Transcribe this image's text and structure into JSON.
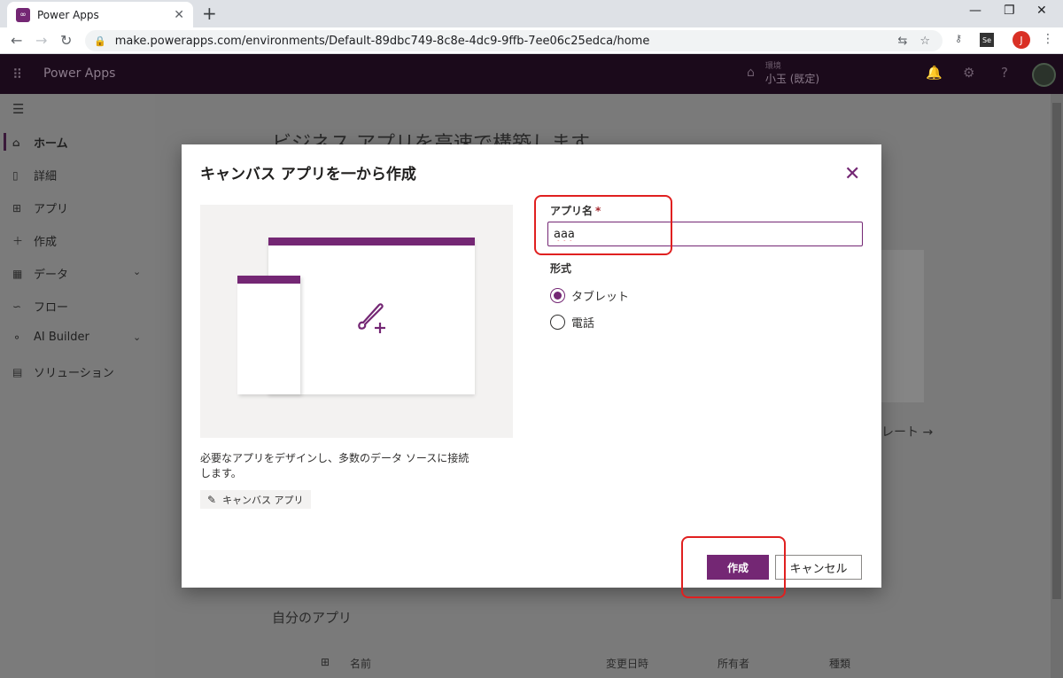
{
  "browser": {
    "tab_title": "Power Apps",
    "tab_favicon": "∞",
    "url": "make.powerapps.com/environments/Default-89dbc749-8c8e-4dc9-9ffb-7ee06c25edca/home",
    "profile_initial": "J",
    "extension_label": "Se"
  },
  "header": {
    "brand": "Power Apps",
    "env_label": "環境",
    "env_name": "小玉 (既定)"
  },
  "sidebar": {
    "items": [
      {
        "label": "ホーム",
        "icon": "home-icon"
      },
      {
        "label": "詳細",
        "icon": "book-icon"
      },
      {
        "label": "アプリ",
        "icon": "apps-icon"
      },
      {
        "label": "作成",
        "icon": "plus-icon"
      },
      {
        "label": "データ",
        "icon": "table-icon"
      },
      {
        "label": "フロー",
        "icon": "flow-icon"
      },
      {
        "label": "AI Builder",
        "icon": "ai-builder-icon"
      },
      {
        "label": "ソリューション",
        "icon": "solution-icon"
      }
    ]
  },
  "background": {
    "title": "ビジネス アプリを高速で構築します",
    "link_tail": "レート →",
    "my_apps": "自分のアプリ",
    "columns": [
      "名前",
      "変更日時",
      "所有者",
      "種類"
    ]
  },
  "dialog": {
    "title": "キャンバス アプリを一から作成",
    "description": "必要なアプリをデザインし、多数のデータ ソースに接続します。",
    "tag": "キャンバス アプリ",
    "app_name_label": "アプリ名",
    "required_mark": "*",
    "app_name_value": "aaa",
    "format_label": "形式",
    "format_options": [
      {
        "label": "タブレット",
        "selected": true
      },
      {
        "label": "電話",
        "selected": false
      }
    ],
    "create_label": "作成",
    "cancel_label": "キャンセル"
  },
  "colors": {
    "accent": "#742774",
    "annotation": "#e02020"
  }
}
